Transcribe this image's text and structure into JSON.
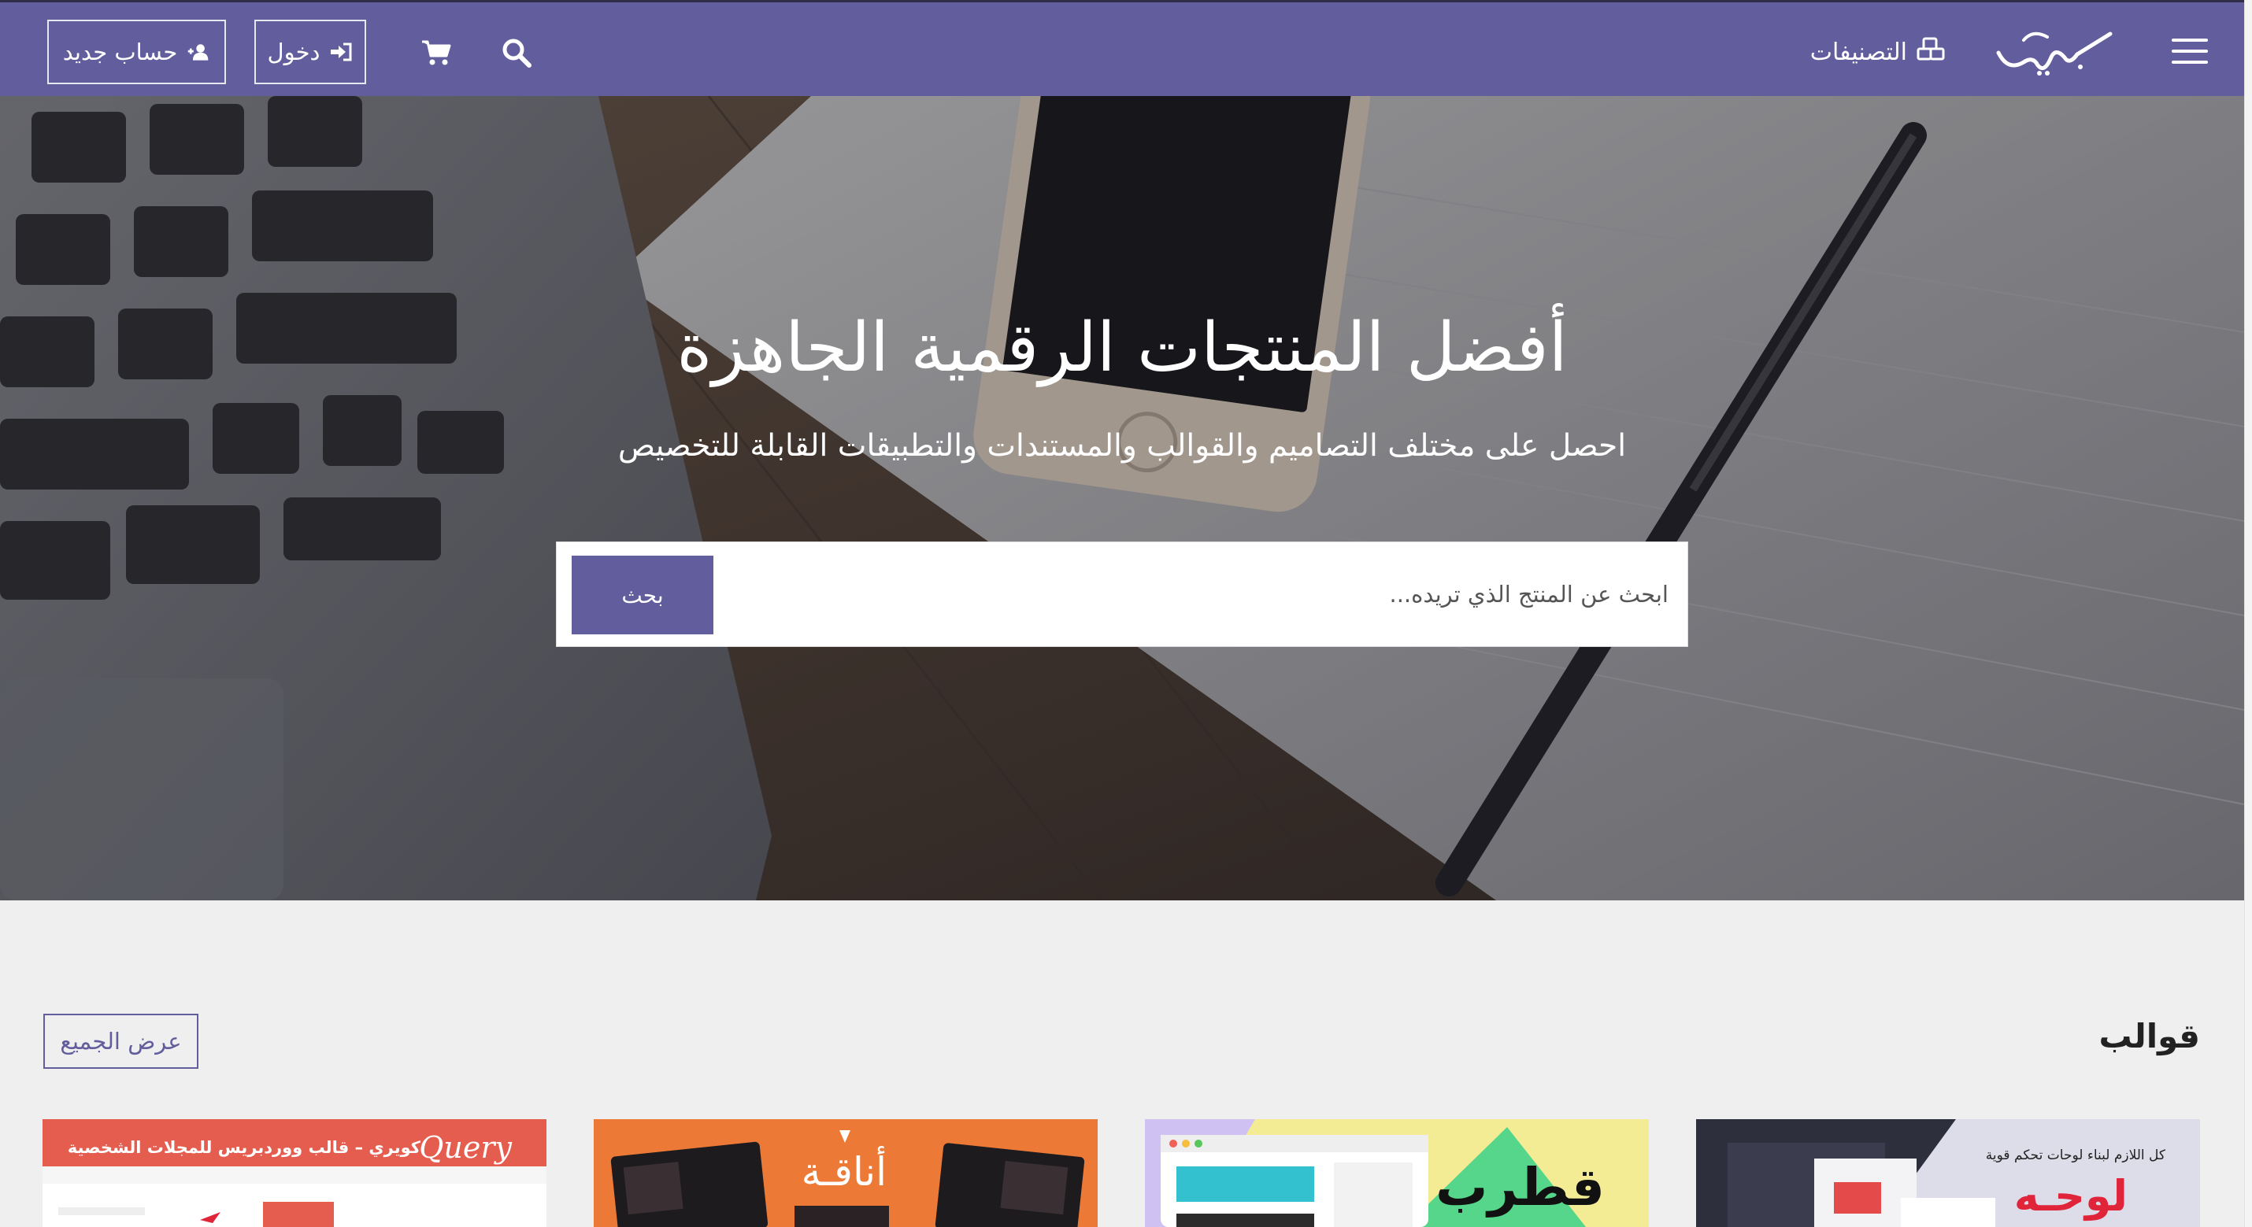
{
  "header": {
    "logo_text": "بيكاليكا",
    "categories_label": "التصنيفات",
    "login_label": "دخول",
    "register_label": "حساب جديد",
    "icons": [
      "menu-icon",
      "categories-icon",
      "search-icon",
      "cart-icon",
      "sign-in-icon",
      "user-plus-icon"
    ],
    "bg_color": "#625d9c"
  },
  "hero": {
    "title": "أفضل المنتجات الرقمية الجاهزة",
    "subtitle": "احصل على مختلف التصاميم والقوالب والمستندات والتطبيقات القابلة للتخصيص",
    "search_placeholder": "ابحث عن المنتج الذي تريده...",
    "search_button": "بحث"
  },
  "section": {
    "title": "قوالب",
    "view_all": "عرض الجميع"
  },
  "cards": [
    {
      "headline": "كل اللازم لبناء لوحات تحكم قوية",
      "brand": "لوحـه"
    },
    {
      "brand": "قطرب"
    },
    {
      "brand": "أناقـة"
    },
    {
      "headline": "كويري – قالب ووردبريس للمجلات الشخصية",
      "brand": "Query"
    }
  ],
  "colors": {
    "primary": "#625d9c",
    "page_bg": "#efefef"
  }
}
